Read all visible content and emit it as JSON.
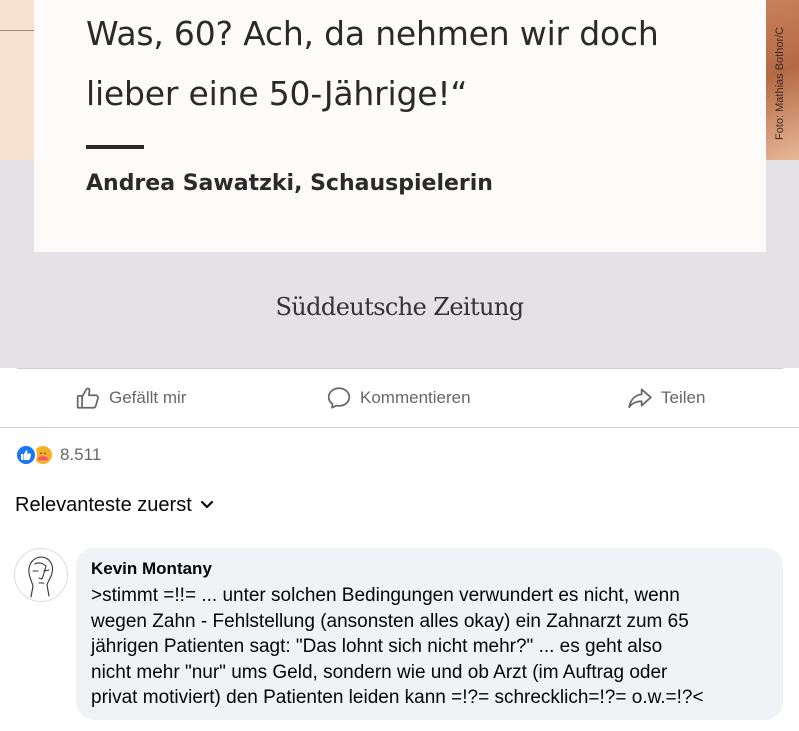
{
  "post_image": {
    "quote_line_1": "Was, 60? Ach, da nehmen wir doch",
    "quote_line_2": "lieber eine 50-Jährige!“",
    "quote_author": "Andrea Sawatzki, Schauspielerin",
    "photo_credit": "Foto: Mathias Bothor/C",
    "publisher": "Süddeutsche Zeitung"
  },
  "actions": {
    "like_label": "Gefällt mir",
    "comment_label": "Kommentieren",
    "share_label": "Teilen"
  },
  "reactions": {
    "count": "8.511",
    "types": [
      "like-icon",
      "care-icon"
    ]
  },
  "comments_sort": {
    "label": "Relevanteste zuerst"
  },
  "comment": {
    "author": "Kevin Montany",
    "text": ">stimmt =!!= ... unter solchen Bedingungen verwundert es nicht, wenn\nwegen Zahn - Fehlstellung (ansonsten alles okay)  ein Zahnarzt zum 65\njährigen Patienten sagt: \"Das lohnt sich nicht mehr?\" ... es geht also\nnicht mehr \"nur\" ums Geld, sondern wie und ob Arzt (im Auftrag oder\nprivat motiviert) den Patienten leiden kann =!?= schrecklich=!?= o.w.=!?<"
  },
  "colors": {
    "facebook_blue": "#1877f2",
    "secondary_text": "#65676b",
    "bubble_bg": "#f0f2f5",
    "divider": "#ced0d4"
  }
}
